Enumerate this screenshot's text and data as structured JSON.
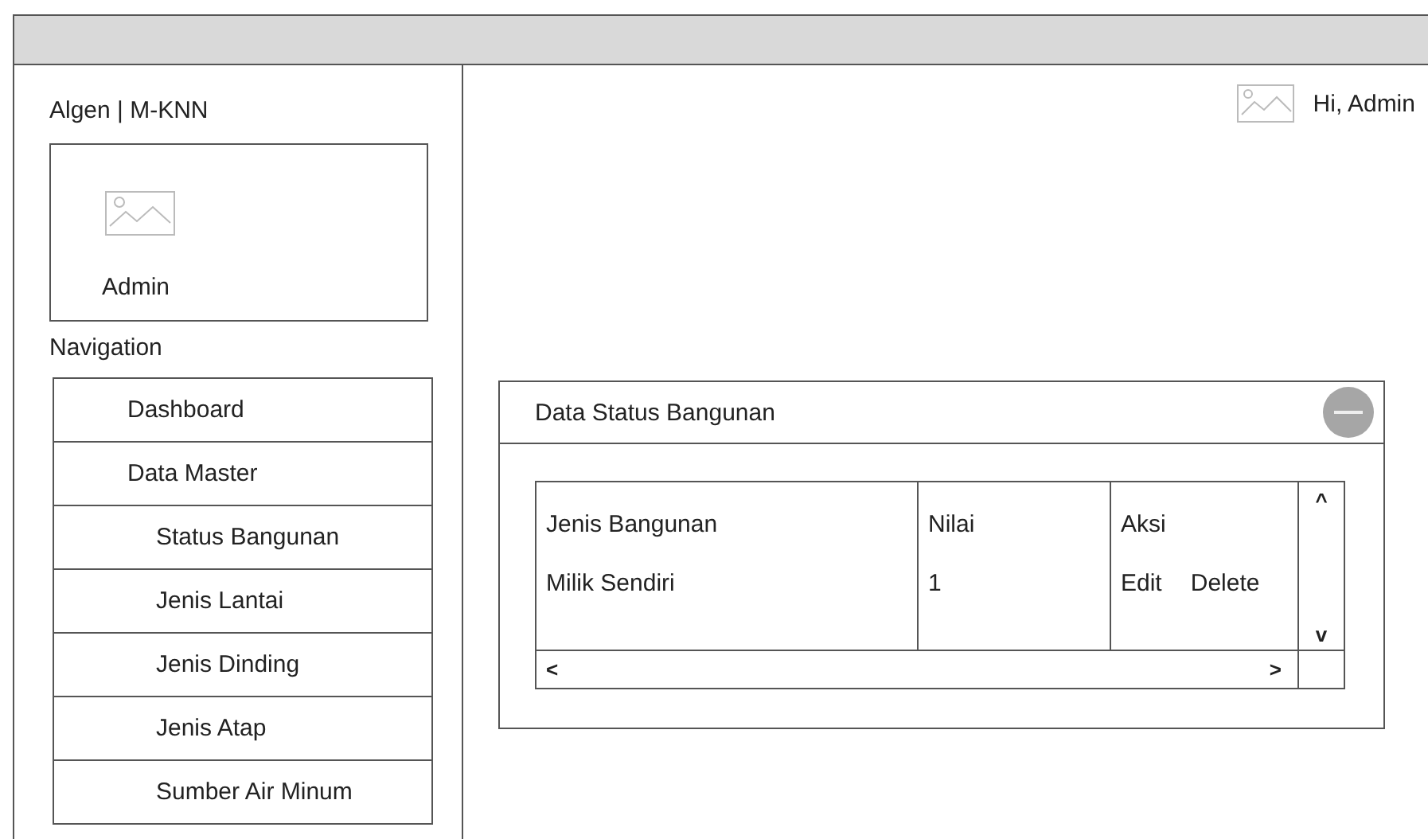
{
  "sidebar": {
    "brand": "Algen | M-KNN",
    "profile": {
      "name": "Admin"
    },
    "nav_heading": "Navigation",
    "items": [
      {
        "label": "Dashboard"
      },
      {
        "label": "Data Master",
        "children": [
          {
            "label": "Status Bangunan"
          },
          {
            "label": "Jenis Lantai"
          },
          {
            "label": "Jenis Dinding"
          },
          {
            "label": "Jenis Atap"
          },
          {
            "label": "Sumber Air Minum"
          }
        ]
      }
    ]
  },
  "header": {
    "greeting": "Hi, Admin"
  },
  "panel": {
    "title": "Data Status Bangunan",
    "table": {
      "columns": [
        "Jenis Bangunan",
        "Nilai",
        "Aksi"
      ],
      "rows": [
        {
          "cells": [
            "Milik Sendiri",
            "1"
          ],
          "actions": [
            "Edit",
            "Delete"
          ]
        }
      ],
      "scroll": {
        "up": "^",
        "down": "v",
        "left": "<",
        "right": ">"
      }
    }
  }
}
